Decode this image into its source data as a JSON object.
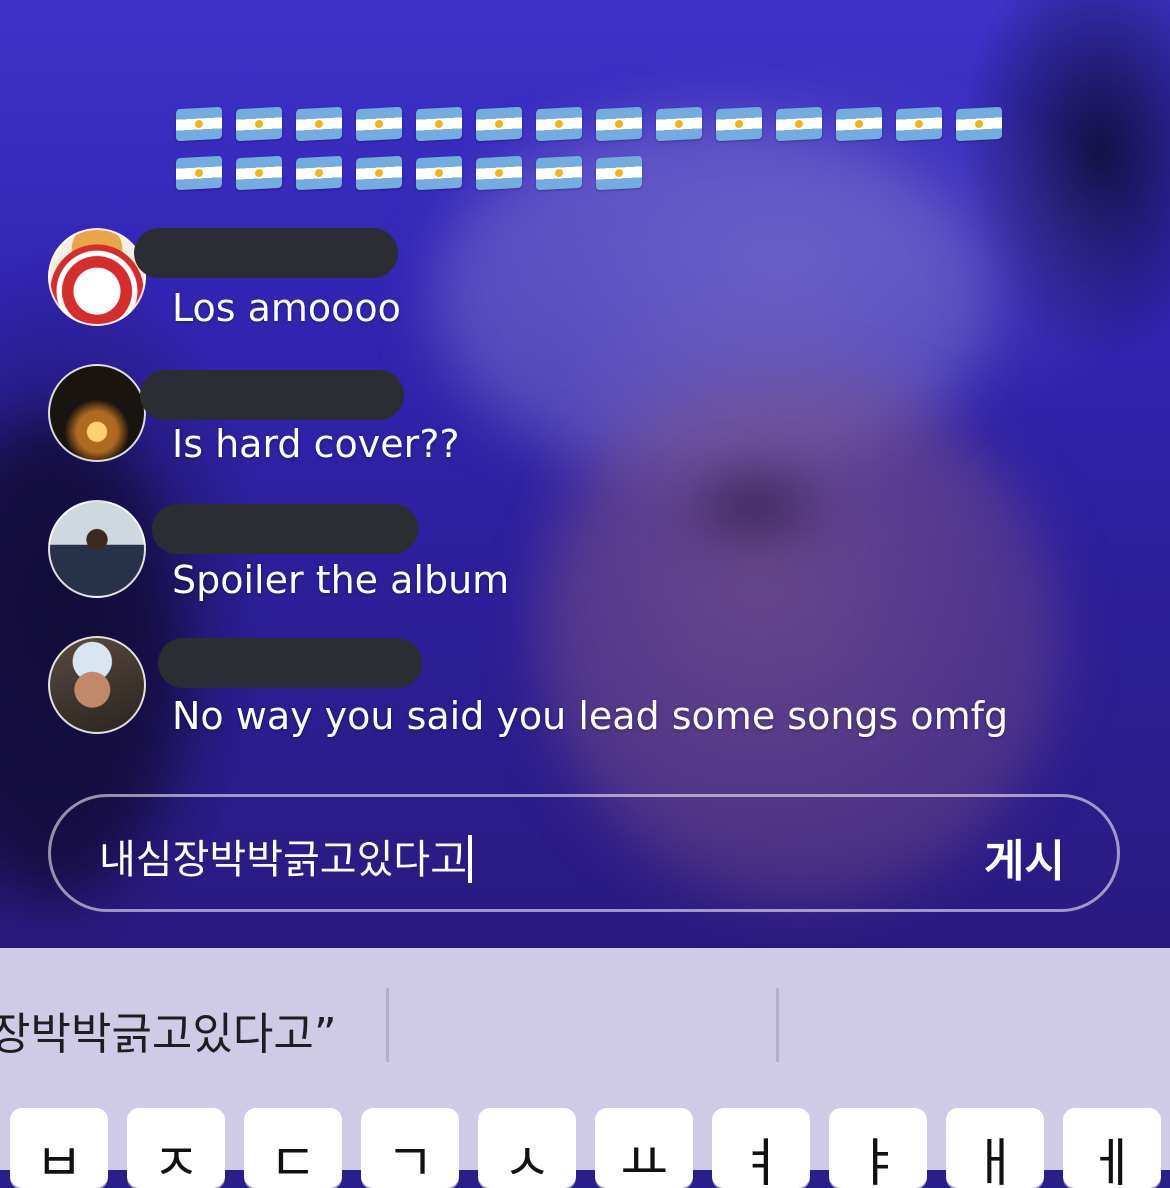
{
  "flags": {
    "emoji_name": "argentina-flag-icon",
    "count": 22
  },
  "comments": [
    {
      "avatar": "avatar-kfc-bucket",
      "text": "Los amoooo"
    },
    {
      "avatar": "avatar-campfire",
      "text": "Is hard cover??"
    },
    {
      "avatar": "avatar-mirror-selfie",
      "text": "Spoiler the album"
    },
    {
      "avatar": "avatar-bucket-hat",
      "text": "No way you said you lead some songs omfg"
    }
  ],
  "input": {
    "value": "내심장박박긁고있다고",
    "post_label": "게시"
  },
  "keyboard": {
    "suggestion": "장박박긁고있다고”",
    "keys": [
      "ㅂ",
      "ㅈ",
      "ㄷ",
      "ㄱ",
      "ㅅ",
      "ㅛ",
      "ㅕ",
      "ㅑ",
      "ㅐ",
      "ㅔ"
    ]
  },
  "colors": {
    "video_tint": "#3325b4",
    "redaction": "#2b2d33",
    "keyboard_bg": "#cfcbe6"
  }
}
